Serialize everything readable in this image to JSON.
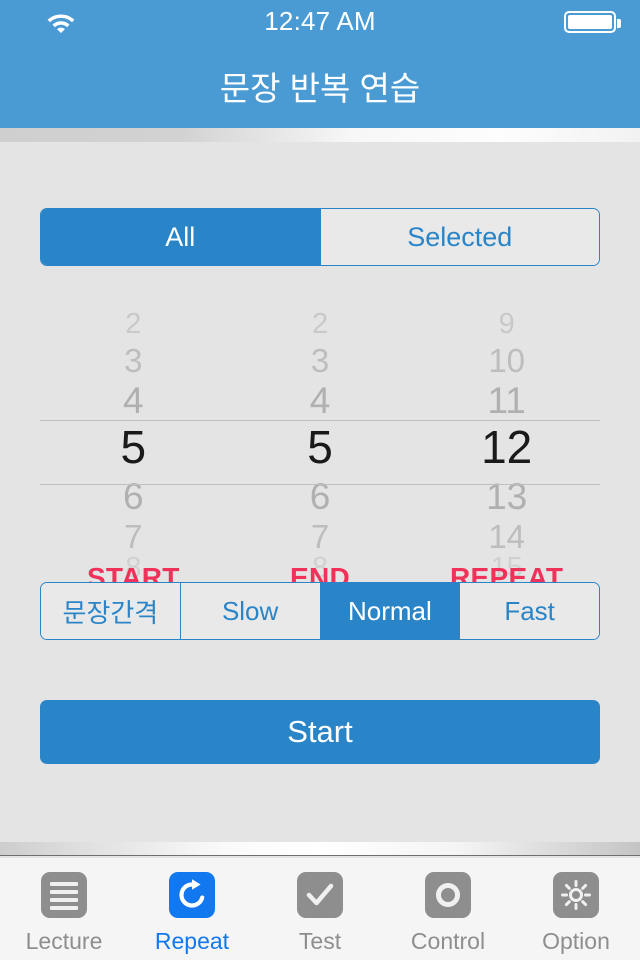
{
  "statusbar": {
    "time": "12:47 AM",
    "wifi_icon": "wifi-icon",
    "battery_icon": "battery-full-icon"
  },
  "navbar": {
    "title": "문장 반복 연습"
  },
  "mode_segment": {
    "options": [
      {
        "label": "All",
        "selected": true
      },
      {
        "label": "Selected",
        "selected": false
      }
    ]
  },
  "picker": {
    "columns": [
      {
        "name": "start",
        "label": "START",
        "selected": "5",
        "above": [
          "2",
          "3",
          "4"
        ],
        "below": [
          "6",
          "7",
          "8"
        ]
      },
      {
        "name": "end",
        "label": "END",
        "selected": "5",
        "above": [
          "2",
          "3",
          "4"
        ],
        "below": [
          "6",
          "7",
          "8"
        ]
      },
      {
        "name": "repeat",
        "label": "REPEAT",
        "selected": "12",
        "above": [
          "9",
          "10",
          "11"
        ],
        "below": [
          "13",
          "14",
          "15"
        ]
      }
    ]
  },
  "speed_segment": {
    "options": [
      {
        "label": "문장간격",
        "selected": false
      },
      {
        "label": "Slow",
        "selected": false
      },
      {
        "label": "Normal",
        "selected": true
      },
      {
        "label": "Fast",
        "selected": false
      }
    ]
  },
  "start_button": {
    "label": "Start"
  },
  "tabbar": {
    "items": [
      {
        "label": "Lecture",
        "icon": "list-lines-icon",
        "active": false
      },
      {
        "label": "Repeat",
        "icon": "repeat-circular-arrow-icon",
        "active": true
      },
      {
        "label": "Test",
        "icon": "checkmark-icon",
        "active": false
      },
      {
        "label": "Control",
        "icon": "circle-ring-icon",
        "active": false
      },
      {
        "label": "Option",
        "icon": "gear-icon",
        "active": false
      }
    ]
  },
  "colors": {
    "navbar_blue": "#4a9bd4",
    "accent_blue": "#2a85c8",
    "tab_active_blue": "#1278f0",
    "label_red": "#f0325a",
    "background_gray": "#e4e4e4",
    "inactive_gray": "#8e8e8e"
  }
}
